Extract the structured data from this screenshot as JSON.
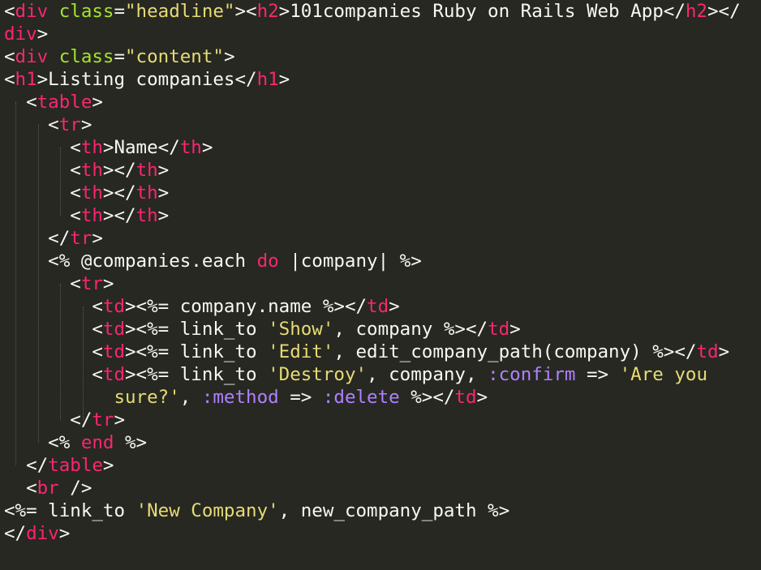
{
  "editor": {
    "theme_colors": {
      "background": "#272822",
      "plain": "#f8f8f2",
      "tag": "#f92672",
      "attribute": "#a6e22e",
      "string": "#e6db74",
      "symbol": "#ae81ff",
      "keyword": "#f92672"
    },
    "lines": [
      [
        [
          "plain",
          "<"
        ],
        [
          "tag",
          "div"
        ],
        [
          "plain",
          " "
        ],
        [
          "attr",
          "class"
        ],
        [
          "plain",
          "="
        ],
        [
          "str",
          "\"headline\""
        ],
        [
          "plain",
          "><"
        ],
        [
          "tag",
          "h2"
        ],
        [
          "plain",
          ">101companies Ruby on Rails Web App</"
        ],
        [
          "tag",
          "h2"
        ],
        [
          "plain",
          "></"
        ]
      ],
      [
        [
          "tag",
          "div"
        ],
        [
          "plain",
          ">"
        ]
      ],
      [
        [
          "plain",
          "<"
        ],
        [
          "tag",
          "div"
        ],
        [
          "plain",
          " "
        ],
        [
          "attr",
          "class"
        ],
        [
          "plain",
          "="
        ],
        [
          "str",
          "\"content\""
        ],
        [
          "plain",
          ">"
        ]
      ],
      [
        [
          "plain",
          "<"
        ],
        [
          "tag",
          "h1"
        ],
        [
          "plain",
          ">Listing companies</"
        ],
        [
          "tag",
          "h1"
        ],
        [
          "plain",
          ">"
        ]
      ],
      [
        [
          "plain",
          "  <"
        ],
        [
          "tag",
          "table"
        ],
        [
          "plain",
          ">"
        ]
      ],
      [
        [
          "plain",
          "    <"
        ],
        [
          "tag",
          "tr"
        ],
        [
          "plain",
          ">"
        ]
      ],
      [
        [
          "plain",
          "      <"
        ],
        [
          "tag",
          "th"
        ],
        [
          "plain",
          ">Name</"
        ],
        [
          "tag",
          "th"
        ],
        [
          "plain",
          ">"
        ]
      ],
      [
        [
          "plain",
          "      <"
        ],
        [
          "tag",
          "th"
        ],
        [
          "plain",
          "></"
        ],
        [
          "tag",
          "th"
        ],
        [
          "plain",
          ">"
        ]
      ],
      [
        [
          "plain",
          "      <"
        ],
        [
          "tag",
          "th"
        ],
        [
          "plain",
          "></"
        ],
        [
          "tag",
          "th"
        ],
        [
          "plain",
          ">"
        ]
      ],
      [
        [
          "plain",
          "      <"
        ],
        [
          "tag",
          "th"
        ],
        [
          "plain",
          "></"
        ],
        [
          "tag",
          "th"
        ],
        [
          "plain",
          ">"
        ]
      ],
      [
        [
          "plain",
          "    </"
        ],
        [
          "tag",
          "tr"
        ],
        [
          "plain",
          ">"
        ]
      ],
      [
        [
          "plain",
          "    <% @companies.each "
        ],
        [
          "kw",
          "do"
        ],
        [
          "plain",
          " |company| %>"
        ]
      ],
      [
        [
          "plain",
          "      <"
        ],
        [
          "tag",
          "tr"
        ],
        [
          "plain",
          ">"
        ]
      ],
      [
        [
          "plain",
          "        <"
        ],
        [
          "tag",
          "td"
        ],
        [
          "plain",
          "><%= company.name %></"
        ],
        [
          "tag",
          "td"
        ],
        [
          "plain",
          ">"
        ]
      ],
      [
        [
          "plain",
          "        <"
        ],
        [
          "tag",
          "td"
        ],
        [
          "plain",
          "><%= link_to "
        ],
        [
          "str",
          "'Show'"
        ],
        [
          "plain",
          ", company %></"
        ],
        [
          "tag",
          "td"
        ],
        [
          "plain",
          ">"
        ]
      ],
      [
        [
          "plain",
          "        <"
        ],
        [
          "tag",
          "td"
        ],
        [
          "plain",
          "><%= link_to "
        ],
        [
          "str",
          "'Edit'"
        ],
        [
          "plain",
          ", edit_company_path(company) %></"
        ],
        [
          "tag",
          "td"
        ],
        [
          "plain",
          ">"
        ]
      ],
      [
        [
          "plain",
          "        <"
        ],
        [
          "tag",
          "td"
        ],
        [
          "plain",
          "><%= link_to "
        ],
        [
          "str",
          "'Destroy'"
        ],
        [
          "plain",
          ", company, "
        ],
        [
          "sym",
          ":confirm"
        ],
        [
          "plain",
          " => "
        ],
        [
          "str",
          "'Are you"
        ]
      ],
      [
        [
          "plain",
          "          "
        ],
        [
          "str",
          "sure?'"
        ],
        [
          "plain",
          ", "
        ],
        [
          "sym",
          ":method"
        ],
        [
          "plain",
          " => "
        ],
        [
          "sym",
          ":delete"
        ],
        [
          "plain",
          " %></"
        ],
        [
          "tag",
          "td"
        ],
        [
          "plain",
          ">"
        ]
      ],
      [
        [
          "plain",
          "      </"
        ],
        [
          "tag",
          "tr"
        ],
        [
          "plain",
          ">"
        ]
      ],
      [
        [
          "plain",
          "    <% "
        ],
        [
          "kw",
          "end"
        ],
        [
          "plain",
          " %>"
        ]
      ],
      [
        [
          "plain",
          "  </"
        ],
        [
          "tag",
          "table"
        ],
        [
          "plain",
          ">"
        ]
      ],
      [
        [
          "plain",
          "  <"
        ],
        [
          "tag",
          "br"
        ],
        [
          "plain",
          " />"
        ]
      ],
      [
        [
          "plain",
          "<%= link_to "
        ],
        [
          "str",
          "'New Company'"
        ],
        [
          "plain",
          ", new_company_path %>"
        ]
      ],
      [
        [
          "plain",
          "</"
        ],
        [
          "tag",
          "div"
        ],
        [
          "plain",
          ">"
        ]
      ]
    ]
  }
}
